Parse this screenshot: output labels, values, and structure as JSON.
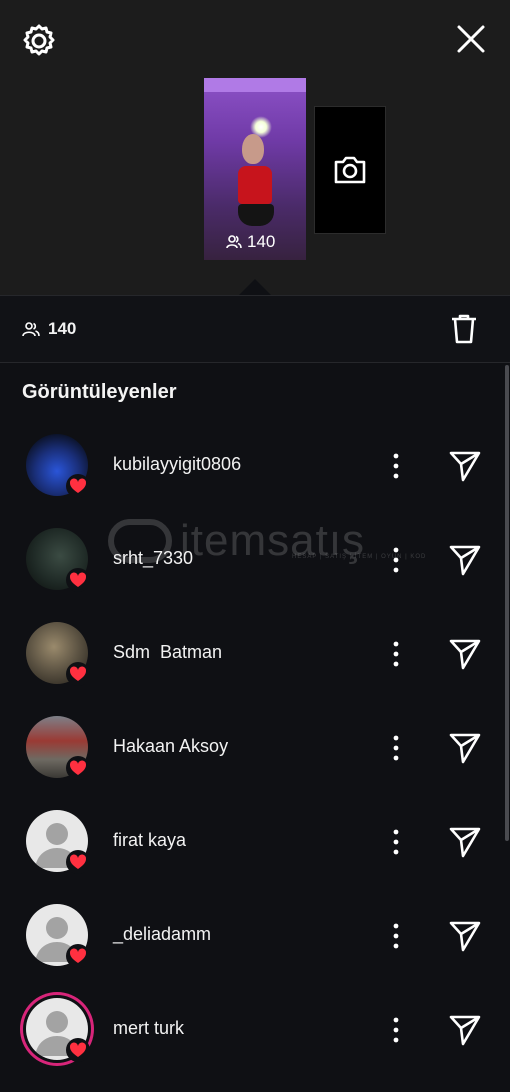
{
  "header": {
    "settings_icon": "gear-icon",
    "close_icon": "close-icon",
    "story_viewer_count": "140",
    "camera_icon": "camera-icon"
  },
  "stats": {
    "viewers_icon": "people-icon",
    "viewer_count": "140",
    "delete_icon": "trash-icon"
  },
  "viewers_section": {
    "title": "Görüntüleyenler",
    "items": [
      {
        "username": "kubilayyigit0806",
        "liked": true,
        "avatar": "photo-car"
      },
      {
        "username": "srht_7330",
        "liked": true,
        "avatar": "photo-man"
      },
      {
        "username": "Sdm  Batman",
        "liked": true,
        "avatar": "photo-person"
      },
      {
        "username": "Hakaan Aksoy",
        "liked": true,
        "avatar": "photo-truck"
      },
      {
        "username": "firat kaya",
        "liked": true,
        "avatar": "default"
      },
      {
        "username": "_deliadamm",
        "liked": true,
        "avatar": "default"
      },
      {
        "username": "mert turk",
        "liked": true,
        "avatar": "default-story-ring"
      }
    ]
  },
  "watermark": {
    "brand": "itemsatış",
    "tagline": "HESAP | SATIŞ | İTEM | OYUN | KOD"
  },
  "colors": {
    "background": "#0f1014",
    "header_background": "#1c1c1c",
    "heart": "#ff3040",
    "story_ring": "#d8257a"
  }
}
